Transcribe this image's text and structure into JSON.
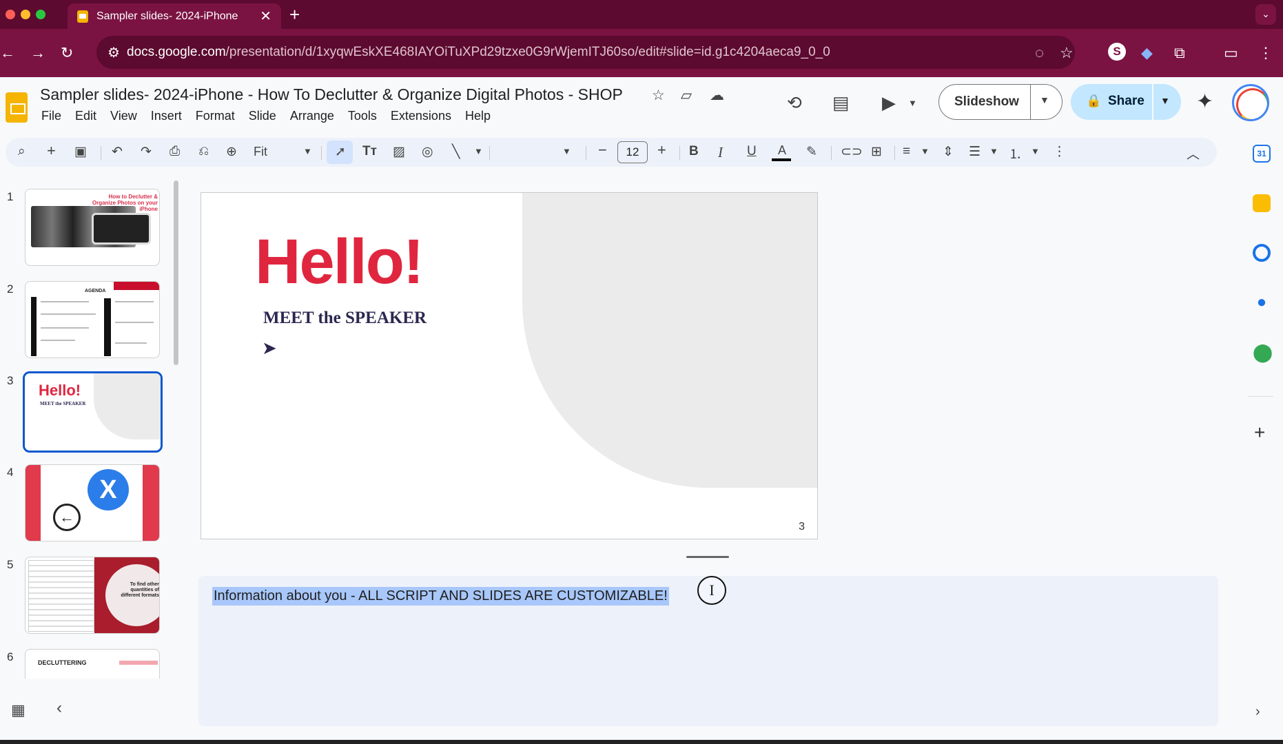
{
  "browser": {
    "tab_title": "Sampler slides- 2024-iPhone",
    "tab_close": "✕",
    "new_tab": "+",
    "url_host": "docs.google.com",
    "url_path": "/presentation/d/1xyqwEskXE468IAYOiTuXPd29tzxe0G9rWjemITJ60so/edit#slide=id.g1c4204aeca9_0_0",
    "ext_s_label": "S"
  },
  "header": {
    "doc_title": "Sampler slides- 2024-iPhone - How To Declutter & Organize Digital Photos - SHOP",
    "menu": [
      "File",
      "Edit",
      "View",
      "Insert",
      "Format",
      "Slide",
      "Arrange",
      "Tools",
      "Extensions",
      "Help"
    ],
    "slideshow_label": "Slideshow",
    "share_label": "Share"
  },
  "toolbar": {
    "zoom_label": "Fit",
    "font_size": "12",
    "bold": "B",
    "italic": "I",
    "underline": "U",
    "text_color": "A"
  },
  "filmstrip": {
    "slides": [
      {
        "number": "1",
        "title": "How to Declutter & Organize Photos on your iPhone"
      },
      {
        "number": "2",
        "title": "AGENDA"
      },
      {
        "number": "3",
        "title": "Hello!",
        "subtitle": "MEET the SPEAKER"
      },
      {
        "number": "4",
        "glyph": "X"
      },
      {
        "number": "5",
        "title": "To find other quantities of different formats"
      },
      {
        "number": "6",
        "title": "DECLUTTERING"
      }
    ]
  },
  "slide": {
    "heading": "Hello!",
    "subheading": "MEET the SPEAKER",
    "arrow": "➤",
    "page_number": "3"
  },
  "notes": {
    "text": "Information about you - ALL SCRIPT AND SLIDES ARE CUSTOMIZABLE!"
  },
  "colors": {
    "browser_tabbar": "#5c0a2f",
    "browser_toolbar": "#7a1342",
    "slide_accent_red": "#e0263f",
    "slide_navy": "#2b2750",
    "selection_blue": "#0b57d0",
    "notes_highlight": "#a8c7fa"
  },
  "icons": [
    "search-icon",
    "add-icon",
    "undo-icon",
    "redo-icon",
    "print-icon",
    "paint-format-icon",
    "zoom-icon",
    "select-icon",
    "text-box-icon",
    "image-icon",
    "shape-icon",
    "line-icon",
    "link-icon",
    "comment-icon",
    "align-icon",
    "line-spacing-icon",
    "bulleted-list-icon",
    "numbered-list-icon",
    "more-icon",
    "history-icon",
    "comments-icon",
    "meet-icon",
    "gemini-icon",
    "calendar-icon",
    "keep-icon",
    "tasks-icon",
    "contacts-icon",
    "maps-icon"
  ]
}
